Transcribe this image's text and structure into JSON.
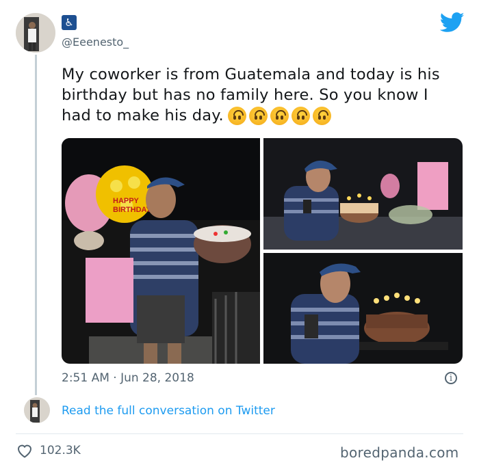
{
  "author": {
    "handle": "@Eeenesto_",
    "badge_icon": "accessible-icon"
  },
  "tweet": {
    "text": "My coworker is from Guatemala and today is his birthday but has no family here. So you know I had to make his day.",
    "emojis": [
      "upside-down-face-icon",
      "upside-down-face-icon",
      "upside-down-face-icon",
      "upside-down-face-icon",
      "upside-down-face-icon"
    ],
    "timestamp": "2:51 AM · Jun 28, 2018",
    "read_link": "Read the full conversation on Twitter",
    "likes": "102.3K"
  },
  "watermark": "boredpanda.com",
  "colors": {
    "link": "#1d9bf0",
    "twitter_blue": "#1da1f2",
    "muted": "#536471"
  }
}
